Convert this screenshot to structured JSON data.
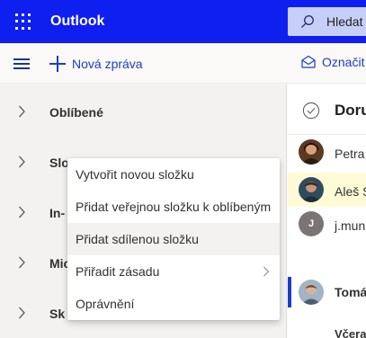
{
  "header": {
    "app_title": "Outlook",
    "search_label": "Hledat",
    "background_color": "#0f1ff0",
    "icons": {
      "launcher": "app-launcher-icon",
      "search": "search-icon"
    }
  },
  "commandbar": {
    "new_mail_label": "Nová zpráva",
    "mark_read_label": "Označit",
    "icons": {
      "menu": "hamburger-menu-icon",
      "new": "plus-icon",
      "mark": "envelope-open-icon"
    }
  },
  "folders": [
    {
      "label": "Oblíbené",
      "icon": "chevron-right-icon"
    },
    {
      "label": "Slo",
      "icon": "chevron-right-icon"
    },
    {
      "label": "In-",
      "icon": "chevron-right-icon"
    },
    {
      "label": "Mic",
      "icon": "chevron-right-icon"
    },
    {
      "label": "Sk",
      "icon": "chevron-right-icon"
    }
  ],
  "message_list": {
    "header_label": "Doru",
    "items": [
      {
        "sender": "Petra",
        "avatar": "photo-avatar",
        "highlighted": false
      },
      {
        "sender": "Aleš S",
        "avatar": "photo-avatar",
        "highlighted": true
      },
      {
        "sender": "j.mun",
        "avatar_initial": "J",
        "highlighted": false
      },
      {
        "sender": "Tomá",
        "avatar": "photo-avatar",
        "selected": true
      }
    ],
    "section_label": "Včera"
  },
  "context_menu": {
    "items": [
      {
        "label": "Vytvořit novou složku"
      },
      {
        "label": "Přidat veřejnou složku k oblíbeným"
      },
      {
        "label": "Přidat sdílenou složku",
        "hovered": true
      },
      {
        "label": "Přiřadit zásadu",
        "has_submenu": true
      },
      {
        "label": "Oprávnění"
      }
    ]
  },
  "colors": {
    "accent": "#1c3fbf",
    "highlight": "#fffbd6",
    "pane": "#f3f2f1"
  }
}
